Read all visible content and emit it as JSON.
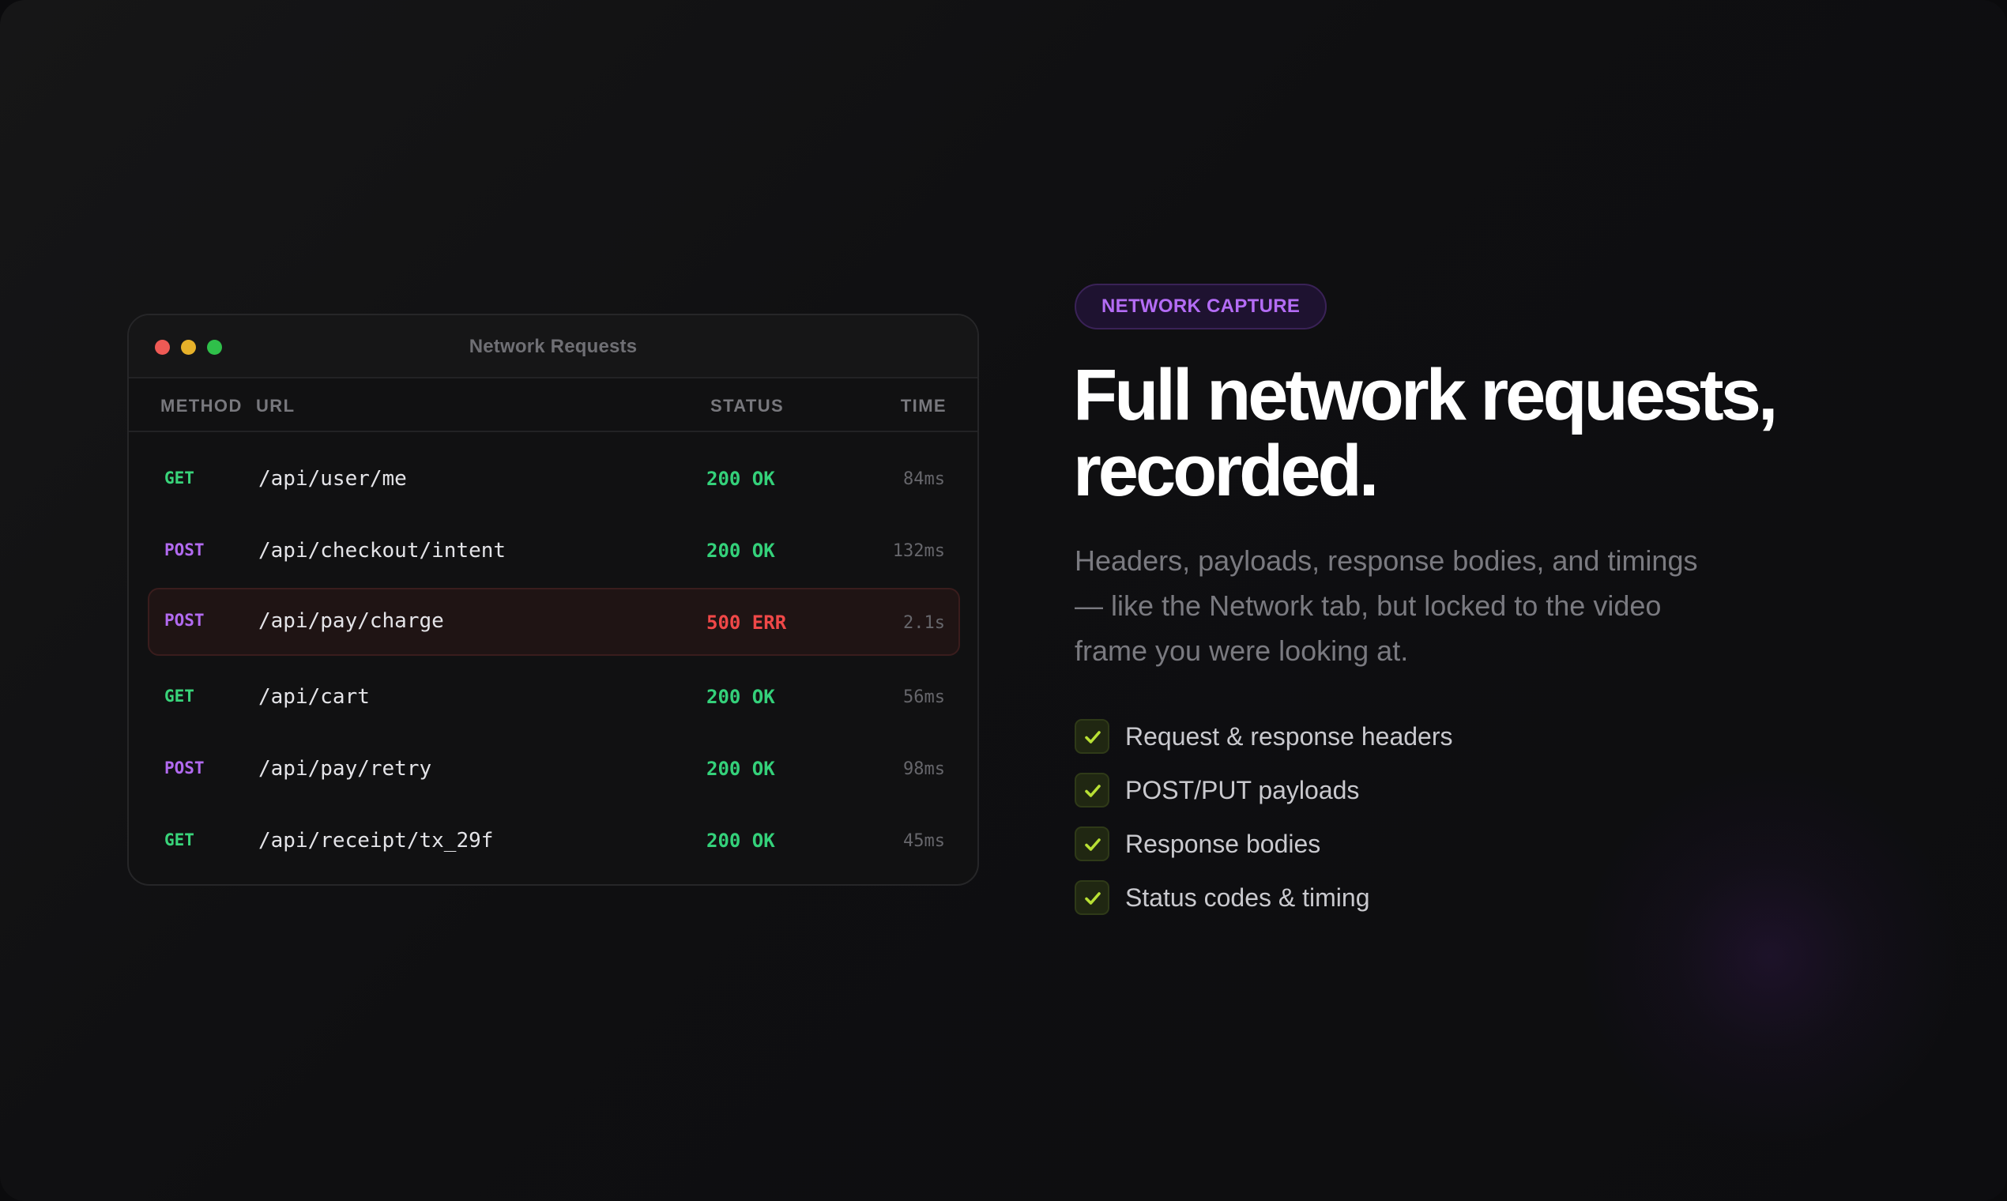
{
  "window": {
    "title": "Network Requests",
    "columns": {
      "method": "METHOD",
      "url": "URL",
      "status": "STATUS",
      "time": "TIME"
    },
    "rows": [
      {
        "method": "GET",
        "url": "/api/user/me",
        "status": "200 OK",
        "time": "84ms"
      },
      {
        "method": "POST",
        "url": "/api/checkout/intent",
        "status": "200 OK",
        "time": "132ms"
      },
      {
        "method": "POST",
        "url": "/api/pay/charge",
        "status": "500 ERR",
        "time": "2.1s",
        "highlighted": true
      },
      {
        "method": "GET",
        "url": "/api/cart",
        "status": "200 OK",
        "time": "56ms"
      },
      {
        "method": "POST",
        "url": "/api/pay/retry",
        "status": "200 OK",
        "time": "98ms"
      },
      {
        "method": "GET",
        "url": "/api/receipt/tx_29f",
        "status": "200 OK",
        "time": "45ms"
      }
    ]
  },
  "badge": {
    "label": "NETWORK CAPTURE"
  },
  "headline": {
    "line1": "Full network requests,",
    "line2": "recorded."
  },
  "subcopy": {
    "line1": "Headers, payloads, response bodies, and timings",
    "line2": "— like the Network tab, but locked to the video",
    "line3": "frame you were looking at."
  },
  "features": [
    {
      "label": "Request & response headers",
      "icon": "check-icon"
    },
    {
      "label": "POST/PUT payloads",
      "icon": "check-icon"
    },
    {
      "label": "Response bodies",
      "icon": "check-icon"
    },
    {
      "label": "Status codes & timing",
      "icon": "check-icon"
    }
  ],
  "colors": {
    "get": "#39d47a",
    "post": "#b26af0",
    "ok": "#34d17a",
    "error": "#f04848",
    "badge_text": "#b46cf5",
    "check": "#b8e034"
  }
}
